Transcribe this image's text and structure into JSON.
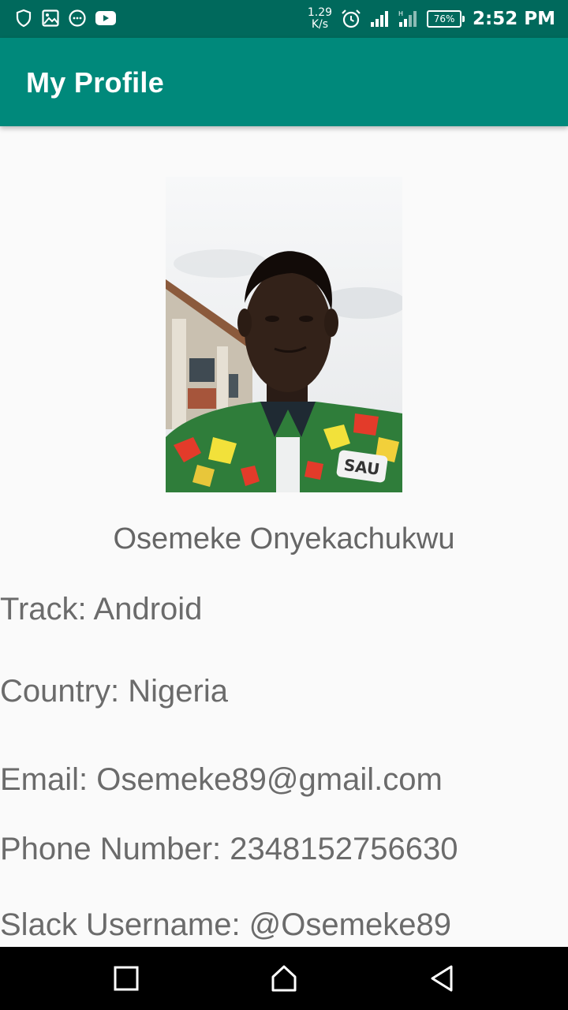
{
  "status_bar": {
    "speed_value": "1.29",
    "speed_unit": "K/s",
    "battery": "76%",
    "time": "2:52 PM",
    "icons": [
      "shield-icon",
      "image-icon",
      "message-bubble-icon",
      "youtube-icon",
      "alarm-icon",
      "signal-icon",
      "signal-icon-2"
    ]
  },
  "app_bar": {
    "title": "My Profile"
  },
  "profile": {
    "name": "Osemeke Onyekachukwu",
    "track": "Track: Android",
    "country": "Country: Nigeria",
    "email": "Email: Osemeke89@gmail.com",
    "phone": "Phone Number: 2348152756630",
    "slack": "Slack Username: @Osemeke89",
    "shirt_text": "SAU"
  },
  "nav_bar": {
    "buttons": [
      "recents-button",
      "home-button",
      "back-button"
    ]
  },
  "colors": {
    "status_bar": "#00695c",
    "app_bar": "#00897b",
    "background": "#fafafa",
    "text": "#6b6b6b"
  }
}
